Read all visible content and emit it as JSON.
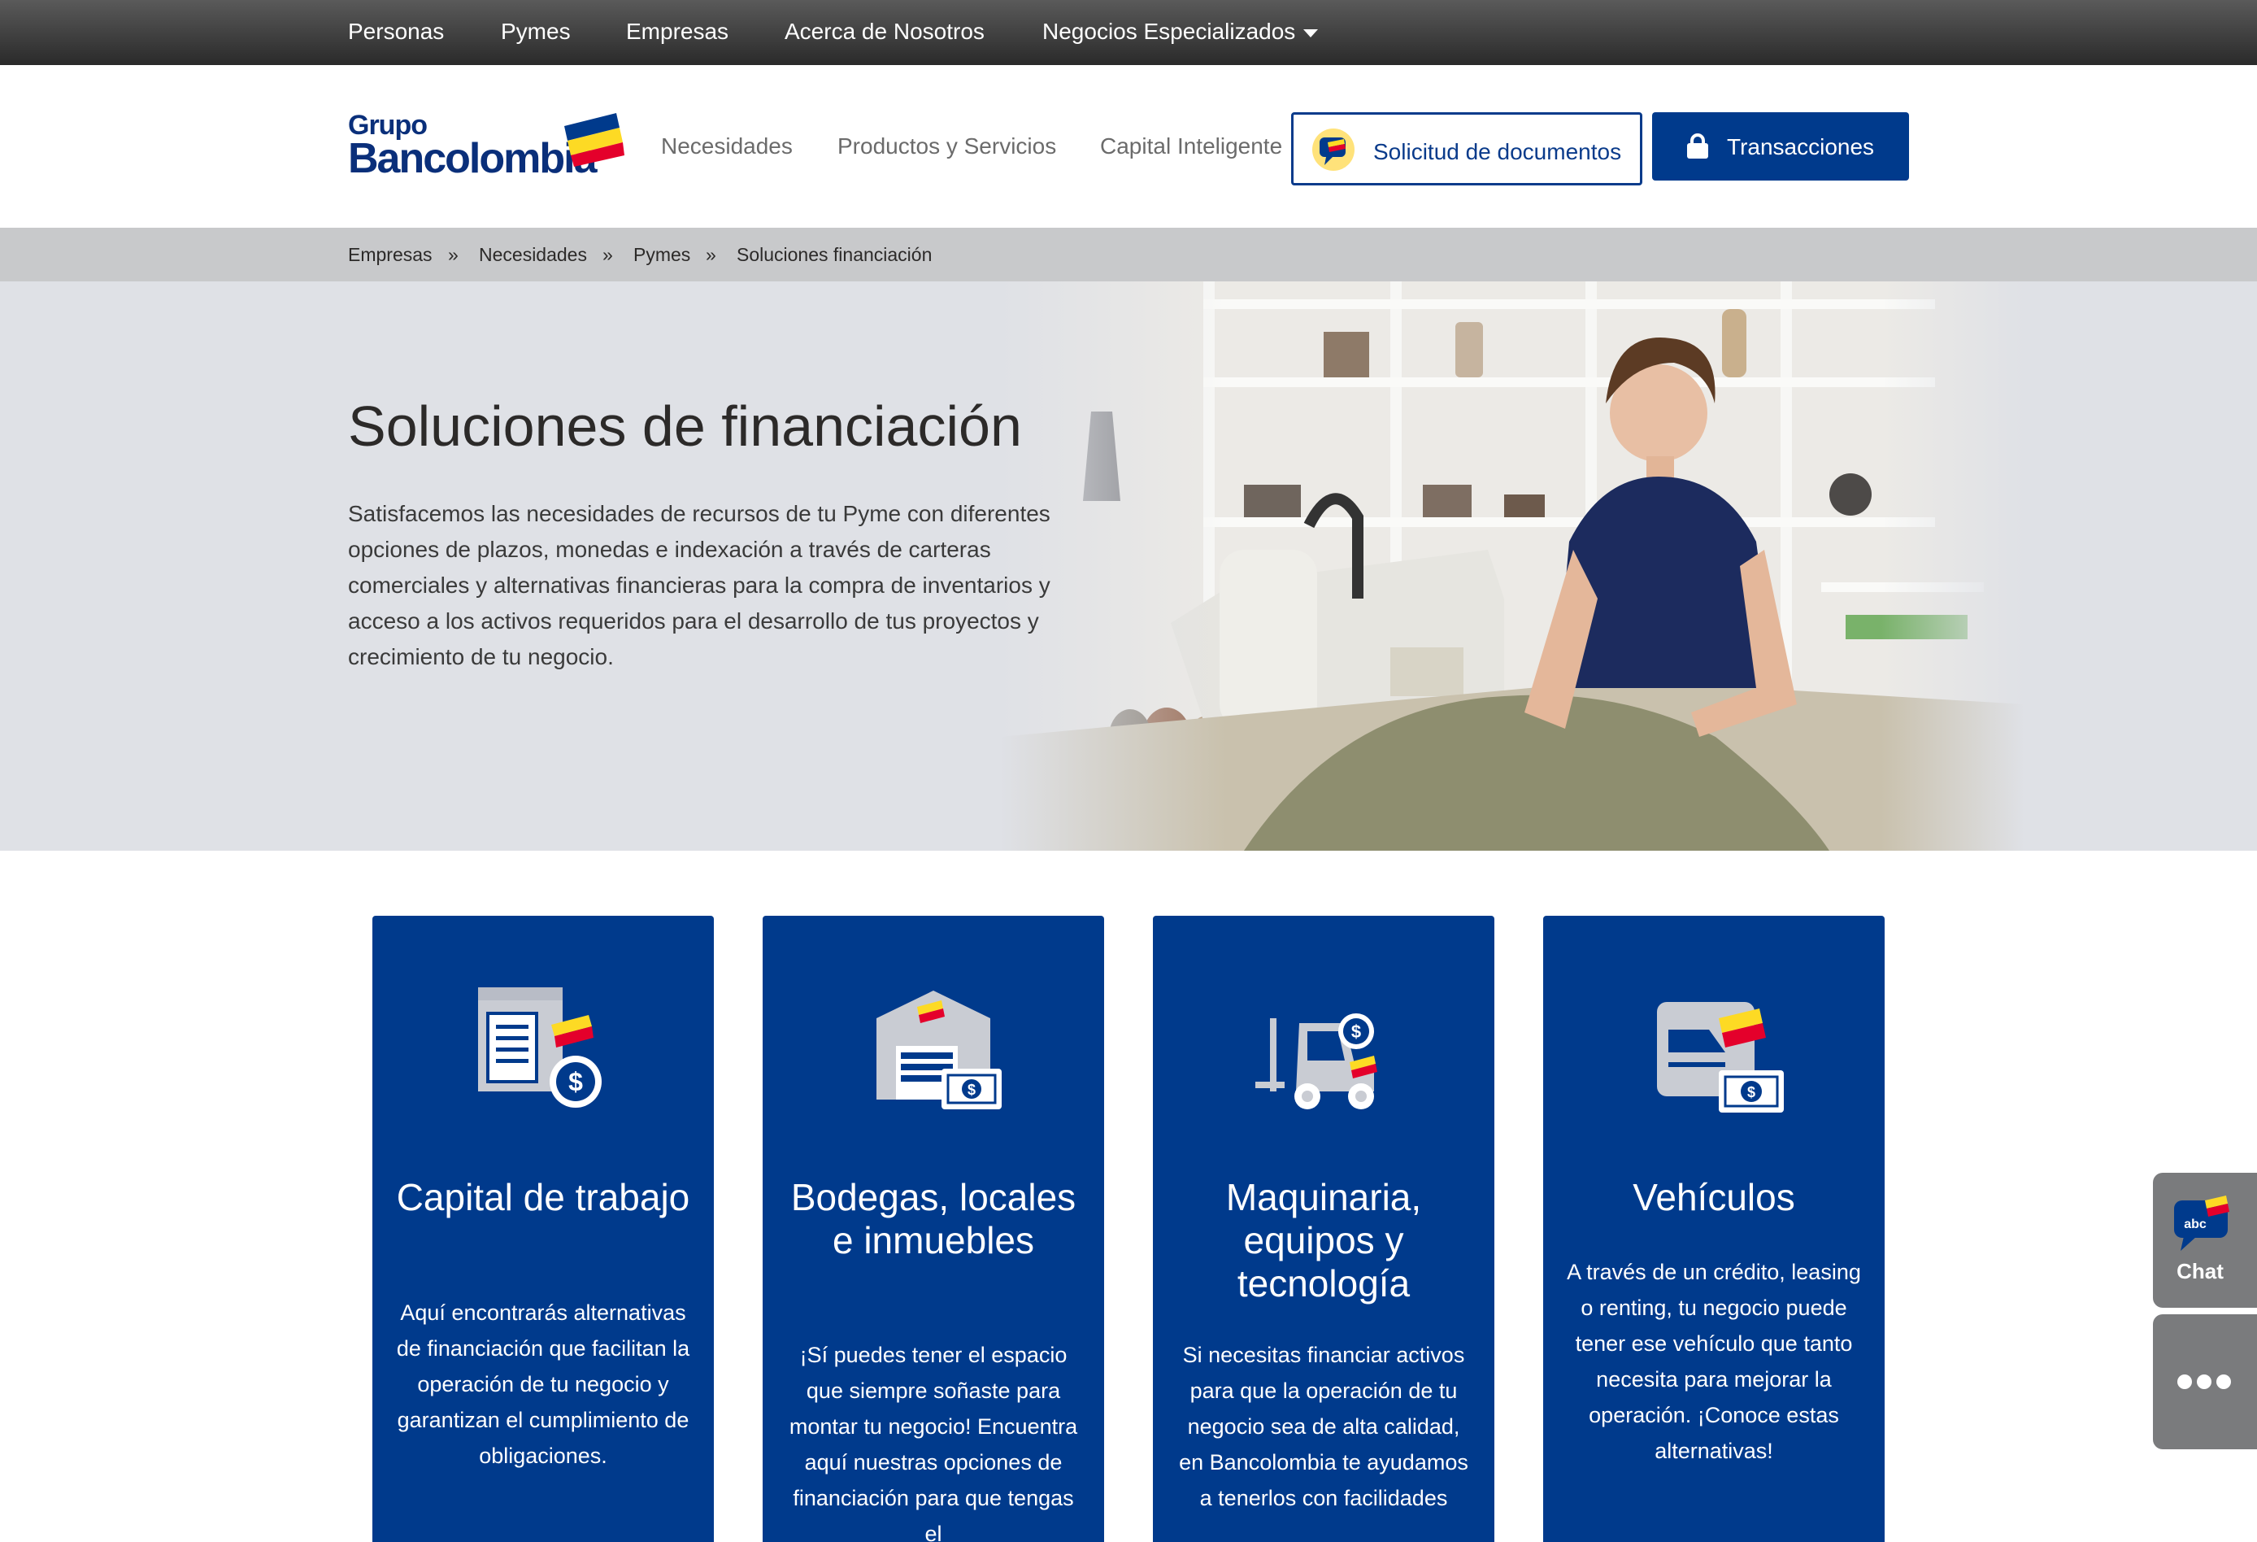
{
  "topnav": {
    "items": [
      "Personas",
      "Pymes",
      "Empresas",
      "Acerca de Nosotros",
      "Negocios Especializados"
    ]
  },
  "header": {
    "logo_line1": "Grupo",
    "logo_line2": "Bancolombia",
    "nav": [
      "Necesidades",
      "Productos y Servicios",
      "Capital Inteligente"
    ],
    "docs_button": "Solicitud de documentos",
    "tx_button": "Transacciones"
  },
  "breadcrumb": {
    "items": [
      "Empresas",
      "Necesidades",
      "Pymes",
      "Soluciones financiación"
    ],
    "separator": "»"
  },
  "hero": {
    "title": "Soluciones de financiación",
    "text": "Satisfacemos las necesidades de recursos de tu Pyme con diferentes opciones de plazos, monedas e indexación a través de carteras comerciales y alternativas financieras para la compra de inventarios y acceso a los activos requeridos para el desarrollo de tus proyectos y crecimiento de tu negocio."
  },
  "cards": [
    {
      "icon": "working-capital-icon",
      "title": "Capital de trabajo",
      "text": "Aquí encontrarás alternativas de financiación que facilitan la operación de tu negocio y  garantizan  el cumplimiento de obligaciones."
    },
    {
      "icon": "warehouse-icon",
      "title": "Bodegas, locales e inmuebles",
      "text": "¡Sí puedes tener el espacio que siempre soñaste para montar tu negocio! Encuentra aquí nuestras opciones de financiación para que tengas el"
    },
    {
      "icon": "forklift-icon",
      "title": "Maquinaria, equipos y tecnología",
      "text": "Si necesitas financiar activos para que la operación de tu negocio sea de alta calidad, en Bancolombia te ayudamos a tenerlos con facilidades"
    },
    {
      "icon": "vehicle-icon",
      "title": "Vehículos",
      "text": "A través de un crédito, leasing o renting, tu negocio puede tener ese vehículo que tanto necesita para mejorar la operación. ¡Conoce estas alternativas!"
    }
  ],
  "side": {
    "chat_badge": "abc",
    "chat_label": "Chat"
  },
  "colors": {
    "brand_blue": "#003a8c",
    "brand_yellow": "#fdda24",
    "brand_red": "#e4002b",
    "topbar": "#3a3a3a",
    "breadcrumb_bg": "#c8c9cb",
    "hero_bg": "#dfe1e6"
  }
}
